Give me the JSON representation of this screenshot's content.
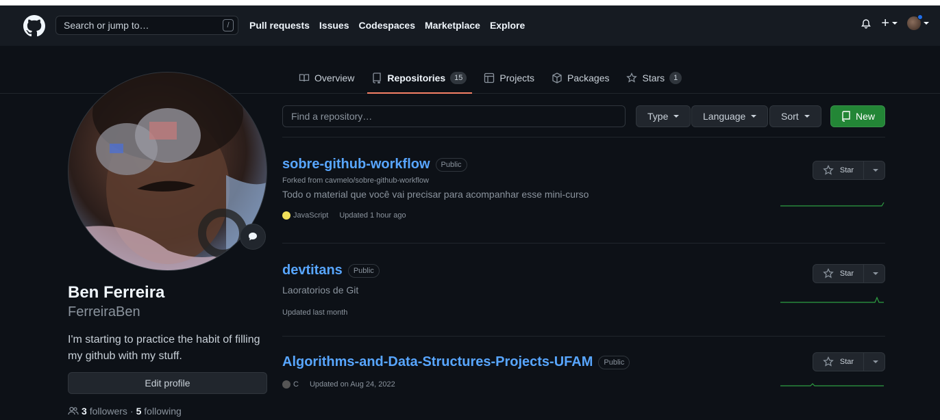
{
  "header": {
    "search_placeholder": "Search or jump to…",
    "search_shortcut": "/",
    "nav": [
      "Pull requests",
      "Issues",
      "Codespaces",
      "Marketplace",
      "Explore"
    ]
  },
  "tabs": [
    {
      "label": "Overview",
      "icon": "book-icon"
    },
    {
      "label": "Repositories",
      "icon": "repo-icon",
      "count": "15",
      "active": true
    },
    {
      "label": "Projects",
      "icon": "table-icon"
    },
    {
      "label": "Packages",
      "icon": "package-icon"
    },
    {
      "label": "Stars",
      "icon": "star-icon",
      "count": "1"
    }
  ],
  "profile": {
    "name": "Ben Ferreira",
    "login": "FerreiraBen",
    "bio": "I'm starting to practice the habit of filling my github with my stuff.",
    "edit_label": "Edit profile",
    "followers_count": "3",
    "followers_label": "followers",
    "separator": "·",
    "following_count": "5",
    "following_label": "following"
  },
  "filters": {
    "find_placeholder": "Find a repository…",
    "type_label": "Type",
    "language_label": "Language",
    "sort_label": "Sort",
    "new_label": "New"
  },
  "repos": [
    {
      "name": "sobre-github-workflow",
      "visibility": "Public",
      "forked_from": "Forked from cavmelo/sobre-github-workflow",
      "description": "Todo o material que você vai precisar para acompanhar esse mini-curso",
      "language": "JavaScript",
      "language_color": "#f1e05a",
      "updated": "Updated 1 hour ago",
      "star_label": "Star"
    },
    {
      "name": "devtitans",
      "visibility": "Public",
      "description": "Laoratorios de Git",
      "updated": "Updated last month",
      "star_label": "Star"
    },
    {
      "name": "Algorithms-and-Data-Structures-Projects-UFAM",
      "visibility": "Public",
      "language": "C",
      "language_color": "#555555",
      "updated": "Updated on Aug 24, 2022",
      "star_label": "Star"
    }
  ],
  "colors": {
    "accent_link": "#58a6ff",
    "new_button": "#238636",
    "active_tab_underline": "#f78166",
    "sparkline": "#2ea043"
  }
}
